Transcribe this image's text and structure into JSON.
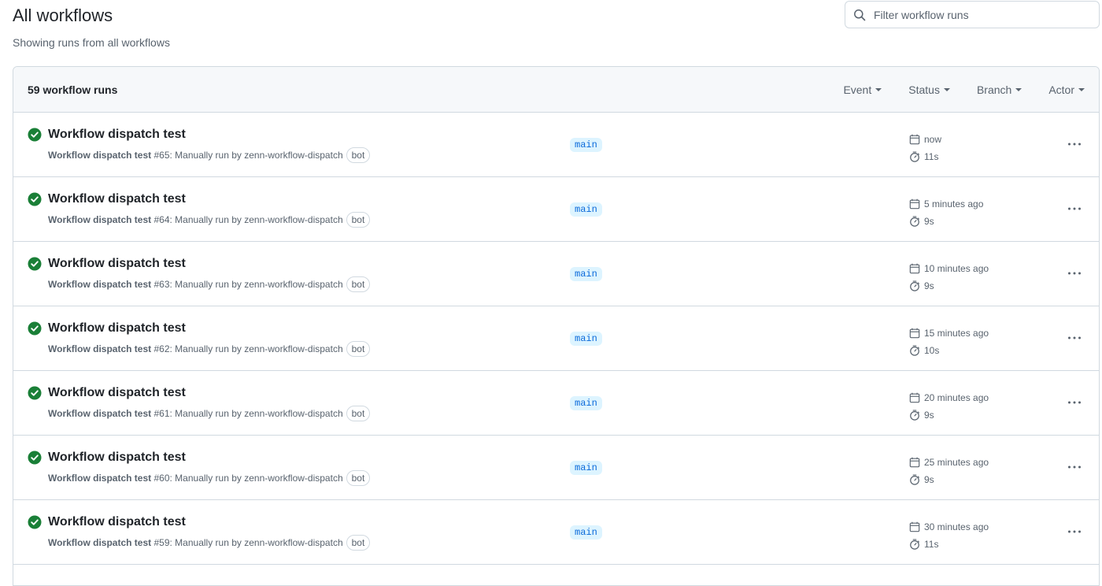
{
  "header": {
    "title": "All workflows",
    "subtitle": "Showing runs from all workflows"
  },
  "search": {
    "placeholder": "Filter workflow runs",
    "value": ""
  },
  "runs_header": {
    "count_label": "59 workflow runs",
    "filters": [
      "Event",
      "Status",
      "Branch",
      "Actor"
    ]
  },
  "colors": {
    "success": "#1a7f37",
    "branch_bg": "#ddf4ff",
    "branch_fg": "#0969da"
  },
  "runs": [
    {
      "title": "Workflow dispatch test",
      "workflow": "Workflow dispatch test",
      "number": "#65",
      "trigger": ": Manually run by zenn-workflow-dispatch",
      "badge": "bot",
      "branch": "main",
      "started": "now",
      "duration": "11s"
    },
    {
      "title": "Workflow dispatch test",
      "workflow": "Workflow dispatch test",
      "number": "#64",
      "trigger": ": Manually run by zenn-workflow-dispatch",
      "badge": "bot",
      "branch": "main",
      "started": "5 minutes ago",
      "duration": "9s"
    },
    {
      "title": "Workflow dispatch test",
      "workflow": "Workflow dispatch test",
      "number": "#63",
      "trigger": ": Manually run by zenn-workflow-dispatch",
      "badge": "bot",
      "branch": "main",
      "started": "10 minutes ago",
      "duration": "9s"
    },
    {
      "title": "Workflow dispatch test",
      "workflow": "Workflow dispatch test",
      "number": "#62",
      "trigger": ": Manually run by zenn-workflow-dispatch",
      "badge": "bot",
      "branch": "main",
      "started": "15 minutes ago",
      "duration": "10s"
    },
    {
      "title": "Workflow dispatch test",
      "workflow": "Workflow dispatch test",
      "number": "#61",
      "trigger": ": Manually run by zenn-workflow-dispatch",
      "badge": "bot",
      "branch": "main",
      "started": "20 minutes ago",
      "duration": "9s"
    },
    {
      "title": "Workflow dispatch test",
      "workflow": "Workflow dispatch test",
      "number": "#60",
      "trigger": ": Manually run by zenn-workflow-dispatch",
      "badge": "bot",
      "branch": "main",
      "started": "25 minutes ago",
      "duration": "9s"
    },
    {
      "title": "Workflow dispatch test",
      "workflow": "Workflow dispatch test",
      "number": "#59",
      "trigger": ": Manually run by zenn-workflow-dispatch",
      "badge": "bot",
      "branch": "main",
      "started": "30 minutes ago",
      "duration": "11s"
    }
  ]
}
